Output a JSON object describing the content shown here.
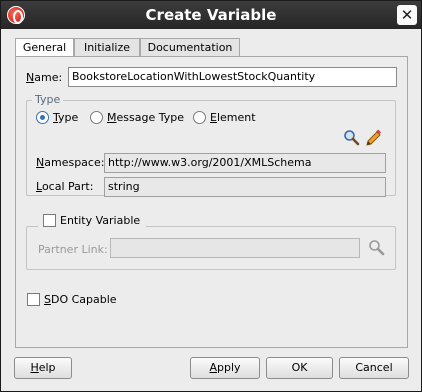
{
  "window": {
    "title": "Create Variable",
    "close_glyph": "✕",
    "app_icon": "oracle-jdeveloper-icon"
  },
  "tabs": [
    {
      "label": "General",
      "active": true
    },
    {
      "label": "Initialize",
      "active": false
    },
    {
      "label": "Documentation",
      "active": false
    }
  ],
  "form": {
    "name_label": "Name:",
    "name_value": "BookstoreLocationWithLowestStockQuantity",
    "type_group_title": "Type",
    "radio_type": "Type",
    "radio_message_type": "Message Type",
    "radio_element": "Element",
    "selected_radio": "Type",
    "namespace_label": "Namespace:",
    "namespace_value": "http://www.w3.org/2001/XMLSchema",
    "local_part_label": "Local Part:",
    "local_part_value": "string",
    "entity_variable_label": "Entity Variable",
    "partner_link_label": "Partner Link:",
    "partner_link_value": "",
    "sdo_capable_label": "SDO Capable"
  },
  "buttons": {
    "help": "Help",
    "apply": "Apply",
    "ok": "OK",
    "cancel": "Cancel"
  },
  "colors": {
    "titlebar": "#2e2e2e",
    "radio_accent": "#3a6fb0",
    "background": "#ececec"
  }
}
